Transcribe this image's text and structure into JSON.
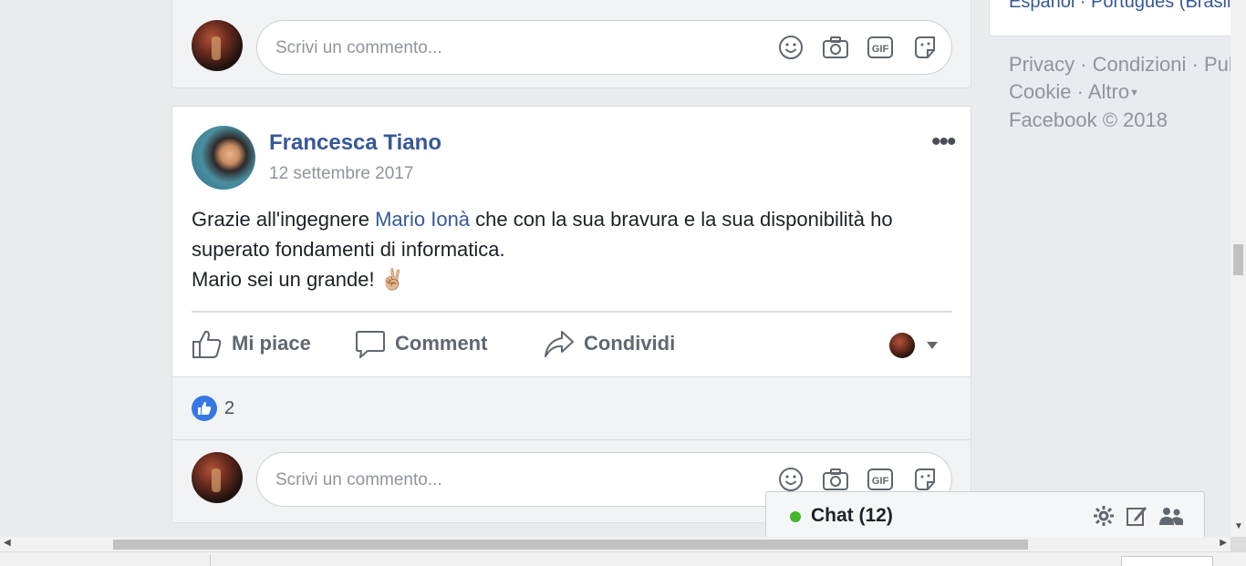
{
  "top_card": {
    "comment_placeholder": "Scrivi un commento..."
  },
  "post": {
    "author": "Francesca Tiano",
    "date": "12 settembre 2017",
    "more_label": "•••",
    "text_before": "Grazie all'ingegnere ",
    "mention": "Mario Ionà",
    "text_after": " che con la sua bravura e la sua disponibilità ho superato fondamenti di informatica.",
    "line2": "Mario sei un grande! ✌🏼",
    "actions": {
      "like": "Mi piace",
      "comment": "Comment",
      "share": "Condividi"
    },
    "like_count": "2",
    "comment_placeholder": "Scrivi un commento..."
  },
  "sidebar": {
    "languages": "Español · Português (Brasil)",
    "footer_line1": "Privacy · Condizioni · Pubblicità",
    "footer_cookie": "Cookie · ",
    "footer_altro": "Altro",
    "footer_copyright": "Facebook © 2018"
  },
  "chat": {
    "label": "Chat (12)",
    "status_color": "#42b72a"
  },
  "icons": [
    "emoji-icon",
    "camera-icon",
    "gif-icon",
    "sticker-icon",
    "like-icon",
    "comment-icon",
    "share-icon",
    "chevron-down-icon",
    "gear-icon",
    "compose-icon",
    "group-icon"
  ],
  "colors": {
    "link": "#365899",
    "like_badge": "#3578e5",
    "background": "#e9ebee"
  }
}
